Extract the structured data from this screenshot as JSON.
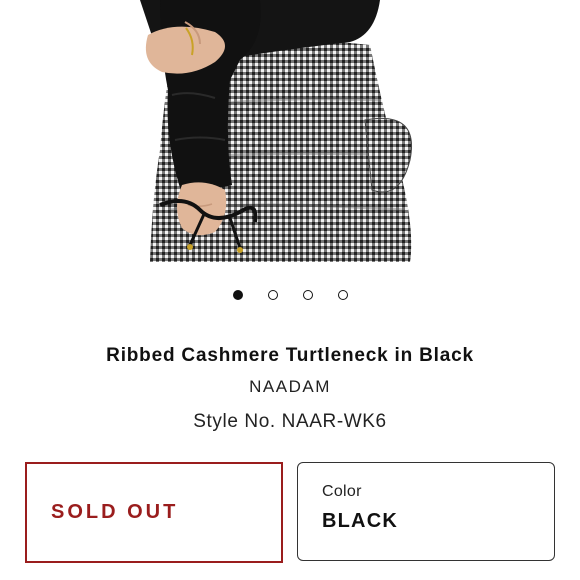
{
  "product": {
    "title": "Ribbed Cashmere Turtleneck in Black",
    "brand": "NAADAM",
    "style": "Style No. NAAR-WK6"
  },
  "carousel": {
    "count": 4,
    "active_index": 0
  },
  "status": {
    "label": "SOLD OUT",
    "color": "#9a1d1d"
  },
  "color": {
    "label": "Color",
    "value": "BLACK"
  }
}
